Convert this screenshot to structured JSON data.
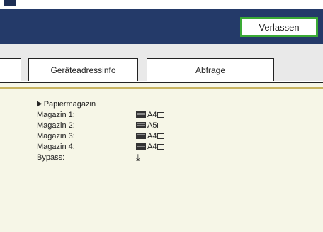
{
  "header": {
    "exit_label": "Verlassen"
  },
  "tabs": [
    {
      "label": ""
    },
    {
      "label": "Geräteadressinfo"
    },
    {
      "label": "Abfrage"
    }
  ],
  "paper": {
    "section_title": "Papiermagazin",
    "rows": [
      {
        "label": "Magazin 1:",
        "size": "A4"
      },
      {
        "label": "Magazin 2:",
        "size": "A5"
      },
      {
        "label": "Magazin 3:",
        "size": "A4"
      },
      {
        "label": "Magazin 4:",
        "size": "A4"
      },
      {
        "label": "Bypass:",
        "size": ""
      }
    ]
  },
  "colors": {
    "header": "#243a69",
    "exit_border": "#3aaa35",
    "content_bg": "#f6f6e7",
    "gold_rule": "#c8b460"
  }
}
